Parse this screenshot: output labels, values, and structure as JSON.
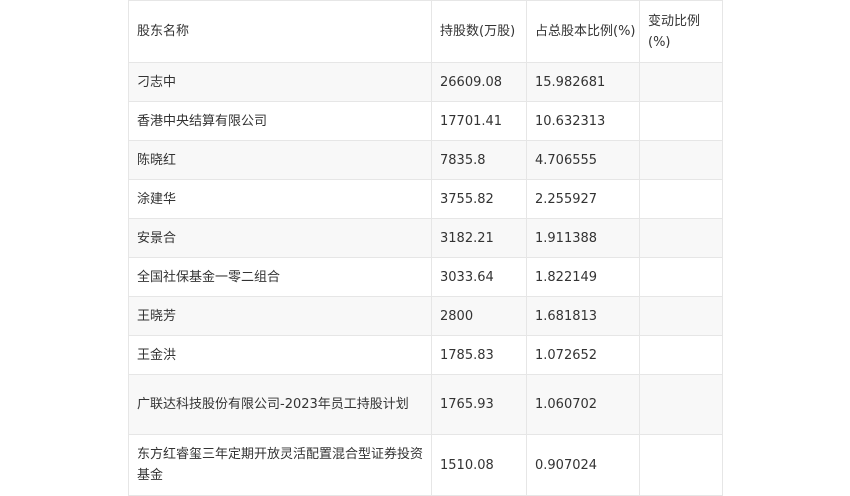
{
  "table": {
    "headers": [
      "股东名称",
      "持股数(万股)",
      "占总股本比例(%)",
      "变动比例(%)"
    ],
    "rows": [
      {
        "name": "刁志中",
        "shares": "26609.08",
        "ratio": "15.982681",
        "change": ""
      },
      {
        "name": "香港中央结算有限公司",
        "shares": "17701.41",
        "ratio": "10.632313",
        "change": ""
      },
      {
        "name": "陈晓红",
        "shares": "7835.8",
        "ratio": "4.706555",
        "change": ""
      },
      {
        "name": "涂建华",
        "shares": "3755.82",
        "ratio": "2.255927",
        "change": ""
      },
      {
        "name": "安景合",
        "shares": "3182.21",
        "ratio": "1.911388",
        "change": ""
      },
      {
        "name": "全国社保基金一零二组合",
        "shares": "3033.64",
        "ratio": "1.822149",
        "change": ""
      },
      {
        "name": "王晓芳",
        "shares": "2800",
        "ratio": "1.681813",
        "change": ""
      },
      {
        "name": "王金洪",
        "shares": "1785.83",
        "ratio": "1.072652",
        "change": ""
      },
      {
        "name": "广联达科技股份有限公司-2023年员工持股计划",
        "shares": "1765.93",
        "ratio": "1.060702",
        "change": ""
      },
      {
        "name": "东方红睿玺三年定期开放灵活配置混合型证券投资基金",
        "shares": "1510.08",
        "ratio": "0.907024",
        "change": ""
      }
    ]
  }
}
